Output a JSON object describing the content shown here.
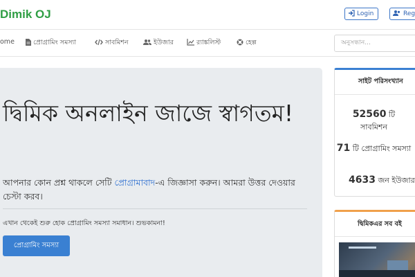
{
  "header": {
    "brand": "Dimik OJ",
    "login_label": "Login",
    "register_label": "Reg"
  },
  "nav": {
    "items": [
      {
        "label": "ome",
        "icon": "home-icon"
      },
      {
        "label": "প্রোগ্রামিং সমস্যা",
        "icon": "file-icon"
      },
      {
        "label": "সাবমিশন",
        "icon": "code-icon"
      },
      {
        "label": "ইউজার",
        "icon": "users-icon"
      },
      {
        "label": "র‍্যাঙ্কলিস্ট",
        "icon": "chart-icon"
      },
      {
        "label": "হেল্প",
        "icon": "lifebuoy-icon"
      }
    ],
    "search_placeholder": "অনুসন্ধান..."
  },
  "hero": {
    "title": "দ্বিমিক অনলাইন জাজে স্বাগতম!",
    "lead_before": "আপনার কোন প্রশ্ন থাকলে সেটি ",
    "lead_link": "প্রোগ্রামাবাদ",
    "lead_after": "-এ জিজ্ঞাসা করুন। আমরা উত্তর দেওয়ার চেস্টা করব।",
    "sub": "এখান থেকেই শুরু হোক প্রোগ্রামিং সমস্যা সমাধান। শুভকামনা!",
    "cta_label": "প্রোগ্রামিং সমস্যা"
  },
  "stats_card": {
    "title": "সাইট পরিসংখ্যান",
    "stats": [
      {
        "number": "52560",
        "unit": "টি",
        "label": "সাবমিশন"
      },
      {
        "number": "71",
        "unit": "টি",
        "label": "প্রোগ্রামিং সমস্যা"
      },
      {
        "number": "4633",
        "unit": "জন",
        "label": "ইউজার"
      }
    ]
  },
  "books_card": {
    "title": "দ্বিমিকএর সব বই"
  },
  "colors": {
    "brand": "#2f9e44",
    "primary": "#3a80d2",
    "jumbotron": "#e9ecef",
    "books_accent": "#f0a04b"
  }
}
